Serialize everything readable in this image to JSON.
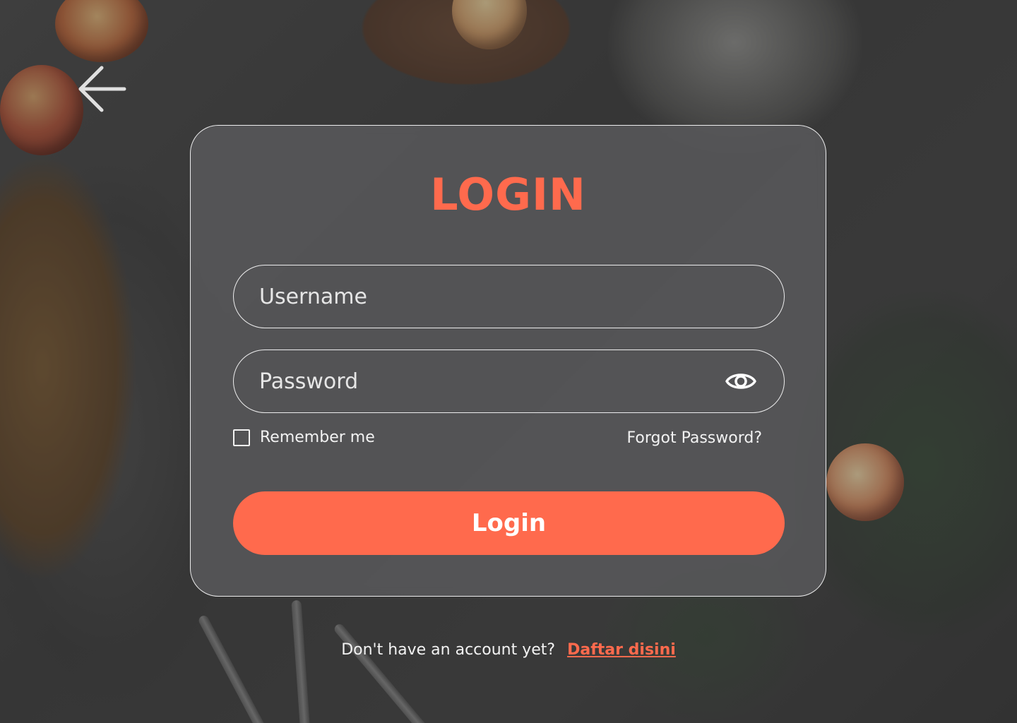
{
  "page": {
    "accent_color": "#ff6a4d",
    "back_icon": "arrow-left-icon"
  },
  "login_card": {
    "title": "LOGIN",
    "username": {
      "placeholder": "Username",
      "value": ""
    },
    "password": {
      "placeholder": "Password",
      "value": "",
      "toggle_icon": "eye-icon"
    },
    "remember_me": {
      "label": "Remember me",
      "checked": false
    },
    "forgot_password": "Forgot Password?",
    "submit_label": "Login"
  },
  "footer": {
    "prompt": "Don't have an account yet?",
    "signup_link": "Daftar disini"
  }
}
